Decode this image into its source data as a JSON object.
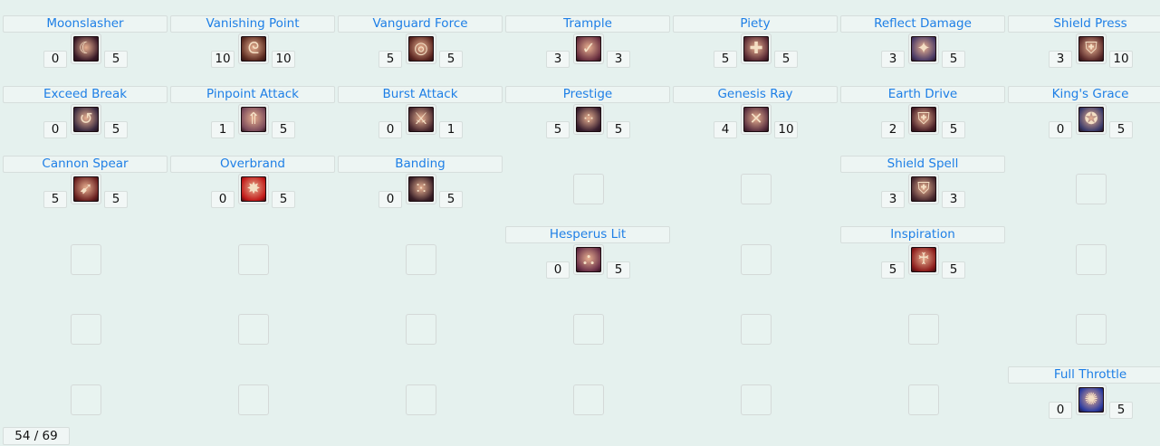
{
  "skills_grid": [
    [
      {
        "name": "Moonslasher",
        "current": "0",
        "max": "5",
        "icon": "crescent-moon-icon",
        "glyph": "☾",
        "color": "#3a1a28"
      },
      {
        "name": "Vanishing Point",
        "current": "10",
        "max": "10",
        "icon": "swirl-slash-icon",
        "glyph": "ᘓ",
        "color": "#5a2a20"
      },
      {
        "name": "Vanguard Force",
        "current": "5",
        "max": "5",
        "icon": "spiral-icon",
        "glyph": "◎",
        "color": "#5a2520"
      },
      {
        "name": "Trample",
        "current": "3",
        "max": "3",
        "icon": "boot-icon",
        "glyph": "✓",
        "color": "#6a3040"
      },
      {
        "name": "Piety",
        "current": "5",
        "max": "5",
        "icon": "cross-shield-icon",
        "glyph": "✚",
        "color": "#5a2a34"
      },
      {
        "name": "Reflect Damage",
        "current": "3",
        "max": "5",
        "icon": "starburst-icon",
        "glyph": "✦",
        "color": "#4a3a66"
      },
      {
        "name": "Shield Press",
        "current": "3",
        "max": "10",
        "icon": "shield-icon",
        "glyph": "⛨",
        "color": "#5a2a2a"
      }
    ],
    [
      {
        "name": "Exceed Break",
        "current": "0",
        "max": "5",
        "icon": "swing-icon",
        "glyph": "↺",
        "color": "#3a2a40"
      },
      {
        "name": "Pinpoint Attack",
        "current": "1",
        "max": "5",
        "icon": "spear-tip-icon",
        "glyph": "⇑",
        "color": "#7a4a5a"
      },
      {
        "name": "Burst Attack",
        "current": "0",
        "max": "1",
        "icon": "sword-icon",
        "glyph": "⚔",
        "color": "#4a2a30"
      },
      {
        "name": "Prestige",
        "current": "5",
        "max": "5",
        "icon": "dots-icon",
        "glyph": "⁘",
        "color": "#3a2030"
      },
      {
        "name": "Genesis Ray",
        "current": "4",
        "max": "10",
        "icon": "crossed-ray-icon",
        "glyph": "✕",
        "color": "#5a3040"
      },
      {
        "name": "Earth Drive",
        "current": "2",
        "max": "5",
        "icon": "shield-strike-icon",
        "glyph": "⛨",
        "color": "#4a2028"
      },
      {
        "name": "King's Grace",
        "current": "0",
        "max": "5",
        "icon": "royal-shield-icon",
        "glyph": "✪",
        "color": "#3a3a6a"
      }
    ],
    [
      {
        "name": "Cannon Spear",
        "current": "5",
        "max": "5",
        "icon": "cannon-spear-icon",
        "glyph": "➹",
        "color": "#6a2020"
      },
      {
        "name": "Overbrand",
        "current": "0",
        "max": "5",
        "icon": "red-burst-icon",
        "glyph": "✸",
        "color": "#c01818"
      },
      {
        "name": "Banding",
        "current": "0",
        "max": "5",
        "icon": "formation-icon",
        "glyph": "⁙",
        "color": "#3a2028"
      },
      null,
      null,
      {
        "name": "Shield Spell",
        "current": "3",
        "max": "3",
        "icon": "magic-shield-icon",
        "glyph": "⛨",
        "color": "#4a2a30"
      },
      null
    ],
    [
      null,
      null,
      null,
      {
        "name": "Hesperus Lit",
        "current": "0",
        "max": "5",
        "icon": "triple-shield-icon",
        "glyph": "⛬",
        "color": "#6a3048"
      },
      null,
      {
        "name": "Inspiration",
        "current": "5",
        "max": "5",
        "icon": "banner-icon",
        "glyph": "♰",
        "color": "#8a1a1a"
      },
      null
    ],
    [
      null,
      null,
      null,
      null,
      null,
      null,
      null
    ],
    [
      null,
      null,
      null,
      null,
      null,
      null,
      {
        "name": "Full Throttle",
        "current": "0",
        "max": "5",
        "icon": "blue-burst-icon",
        "glyph": "✺",
        "color": "#2a3aa0"
      }
    ]
  ],
  "points": {
    "label": "54 / 69"
  }
}
